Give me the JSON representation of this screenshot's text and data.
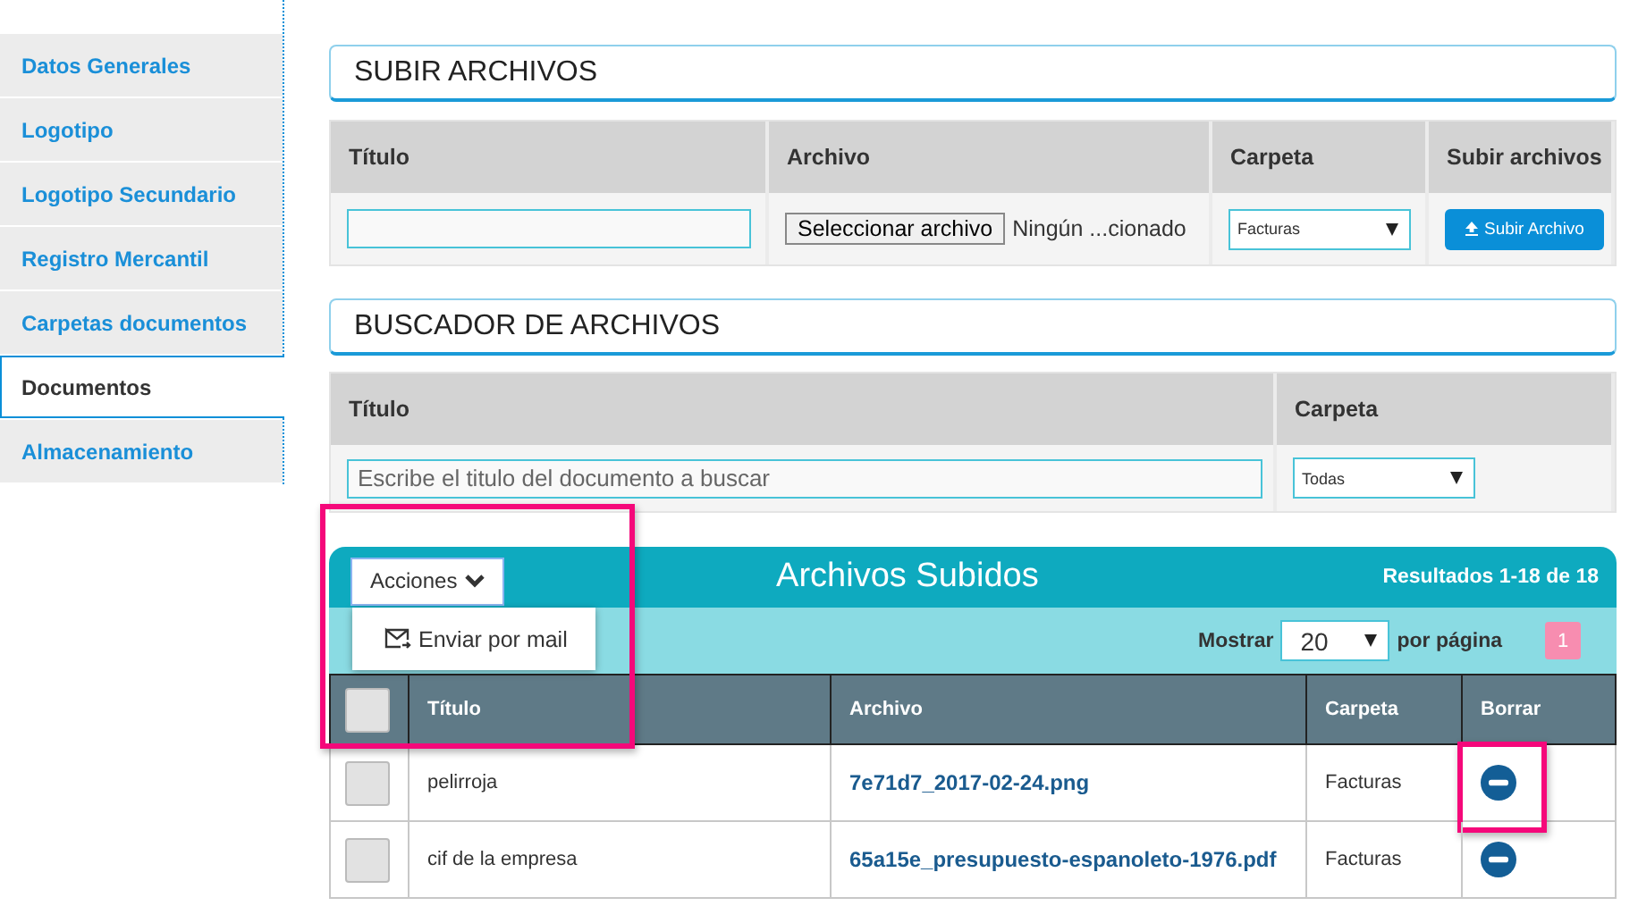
{
  "sidebar": {
    "items": [
      {
        "label": "Datos Generales",
        "selected": false
      },
      {
        "label": "Logotipo",
        "selected": false
      },
      {
        "label": "Logotipo Secundario",
        "selected": false
      },
      {
        "label": "Registro Mercantil",
        "selected": false
      },
      {
        "label": "Carpetas documentos",
        "selected": false
      },
      {
        "label": "Documentos",
        "selected": true
      },
      {
        "label": "Almacenamiento",
        "selected": false
      }
    ]
  },
  "upload": {
    "title": "SUBIR ARCHIVOS",
    "columns": [
      "Título",
      "Archivo",
      "Carpeta",
      "Subir archivos"
    ],
    "file_button": "Seleccionar archivo",
    "file_status": "Ningún ...cionado",
    "folder": "Facturas",
    "submit": "Subir Archivo"
  },
  "search": {
    "title": "BUSCADOR DE ARCHIVOS",
    "columns": [
      "Título",
      "Carpeta"
    ],
    "placeholder": "Escribe el titulo del documento a buscar",
    "folder": "Todas"
  },
  "results": {
    "actions": {
      "label": "Acciones",
      "expanded": true,
      "highlighted": true,
      "items": [
        "Enviar por mail"
      ]
    },
    "title": "Archivos Subidos",
    "summary": "Resultados 1-18 de 18",
    "show_label": "Mostrar",
    "page_size": "20",
    "per_page_label": "por página",
    "pages": [
      {
        "label": "1",
        "selected": true
      }
    ],
    "all_checked": false,
    "columns": [
      "Título",
      "Archivo",
      "Carpeta",
      "Borrar"
    ],
    "rows": [
      {
        "checked": false,
        "title": "pelirroja",
        "file": "7e71d7_2017-02-24.png",
        "folder": "Facturas",
        "highlighted": true
      },
      {
        "checked": false,
        "title": "cif de la empresa",
        "file": "65a15e_presupuesto-espanoleto-1976.pdf",
        "folder": "Facturas"
      }
    ]
  }
}
